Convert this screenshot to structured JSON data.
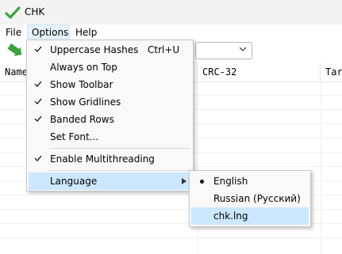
{
  "app": {
    "title": "CHK"
  },
  "menubar": {
    "file": "File",
    "options": "Options",
    "help": "Help"
  },
  "columns": {
    "name": "Name",
    "crc": "CRC-32",
    "target": "Tar"
  },
  "options_menu": {
    "items": [
      {
        "label": "Uppercase Hashes",
        "shortcut": "Ctrl+U",
        "checked": true
      },
      {
        "label": "Always on Top",
        "checked": false
      },
      {
        "label": "Show Toolbar",
        "checked": true
      },
      {
        "label": "Show Gridlines",
        "checked": true
      },
      {
        "label": "Banded Rows",
        "checked": true
      },
      {
        "label": "Set Font...",
        "checked": false
      },
      {
        "label": "Enable Multithreading",
        "checked": true
      },
      {
        "label": "Language",
        "checked": false,
        "submenu": true
      }
    ]
  },
  "language_menu": {
    "items": [
      {
        "label": "English",
        "selected": true
      },
      {
        "label": "Russian (Русский)",
        "selected": false
      },
      {
        "label": "chk.lng",
        "selected": false
      }
    ]
  },
  "colors": {
    "highlight": "#cce8ff",
    "accent_green": "#3aa53a"
  }
}
